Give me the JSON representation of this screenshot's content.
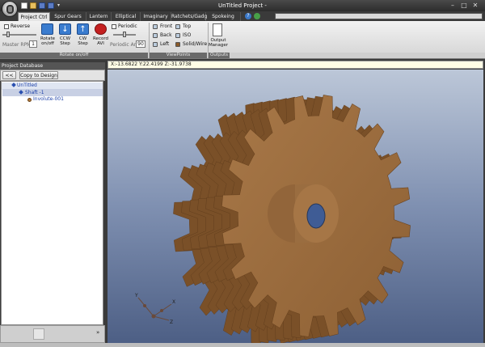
{
  "window": {
    "title": "UnTitled Project -",
    "minimize": "–",
    "maximize": "□",
    "close": "✕"
  },
  "tabs": [
    "Project Ctrl",
    "Spur Gears",
    "Lantern",
    "Elliptical",
    "Imaginary",
    "Ratchets/Gadg",
    "Spokeing Panel"
  ],
  "ribbon": {
    "reverse_label": "Reverse",
    "master_rpm_label": "Master RPM",
    "master_rpm_value": "1",
    "rotate_label": "Rotate on/off",
    "ccw_label": "CCW Step",
    "cw_label": "CW Step",
    "record_label": "Record AVI",
    "periodic_label": "Periodic",
    "periodic_ang_label": "Periodic Ang",
    "periodic_ang_value": "90",
    "group_rotate": "Rotate on/off",
    "view_front": "Front",
    "view_top": "Top",
    "view_back": "Back",
    "view_iso": "ISO",
    "view_left": "Left",
    "view_solid": "Solid/Wire",
    "group_viewpoints": "ViewPoints",
    "output_manager": "Output Manager",
    "group_outputs": "Outputs"
  },
  "left_panel": {
    "header": "Project Database",
    "back_button": "<<",
    "copy_button": "Copy to Design",
    "tree": [
      "UnTitled",
      "Shaft -1",
      "Involute-001"
    ],
    "scroll_arrow": "»"
  },
  "viewport": {
    "coordinates": "X:-13.6822 Y:22.4199 Z:-31.9738",
    "axis_labels": [
      "Y",
      "X",
      "Z"
    ]
  },
  "colors": {
    "gear": "#9b6b3c",
    "gear_shadow": "#7a5028",
    "shaft_hole": "#3f5c95",
    "viewport_top": "#bcc7d8",
    "viewport_bottom": "#4d5f85"
  },
  "icons": [
    "app-orb-icon",
    "new-file-icon",
    "open-folder-icon",
    "save-icon",
    "save-as-icon",
    "help-icon",
    "info-icon"
  ]
}
